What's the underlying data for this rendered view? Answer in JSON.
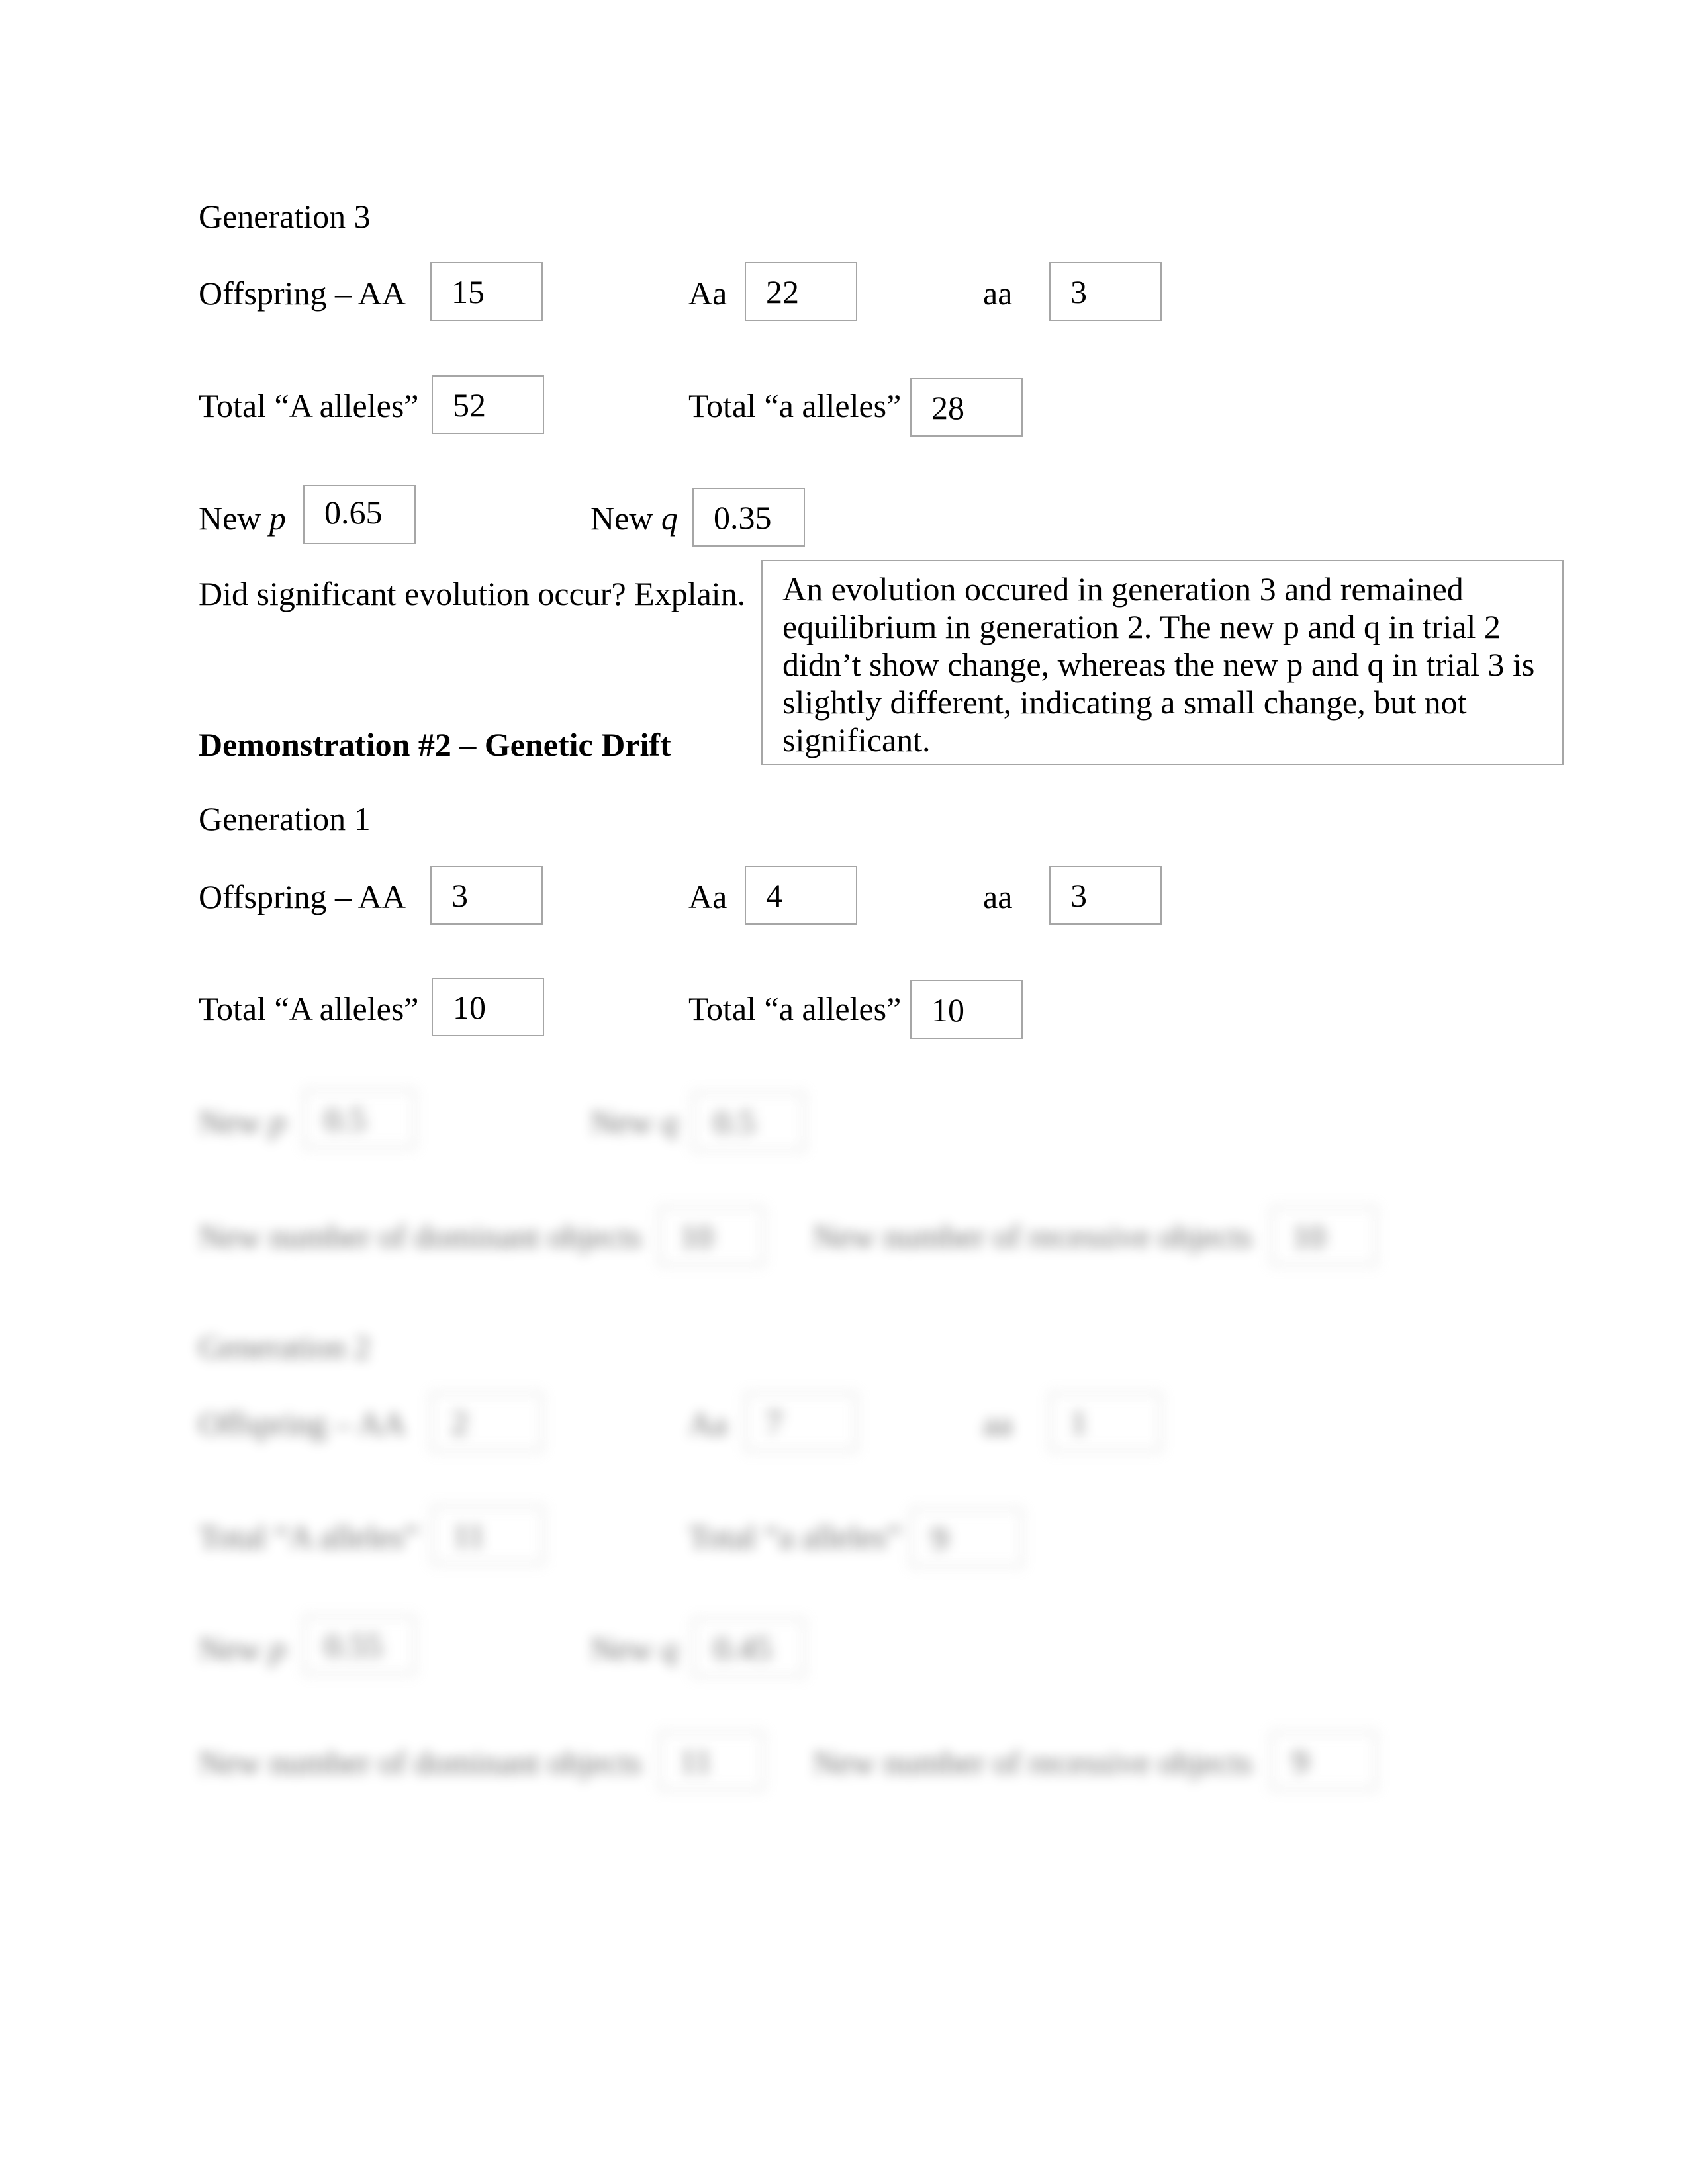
{
  "demo1": {
    "generation3": {
      "heading": "Generation 3",
      "offspring_label": "Offspring – AA",
      "AA": "15",
      "Aa_label": "Aa",
      "Aa": "22",
      "aa_label": "aa",
      "aa": "3",
      "total_A_label": "Total “A alleles”",
      "total_A": "52",
      "total_a_label": "Total “a alleles”",
      "total_a": "28",
      "new_p_label": "New ",
      "new_p_var": "p",
      "new_p": "0.65",
      "new_q_label": "New ",
      "new_q_var": "q",
      "new_q": "0.35"
    },
    "question": "Did significant evolution occur?  Explain.",
    "answer": "An evolution occured in generation 3 and remained equilibrium in generation 2. The new p and q in trial 2 didn’t show change, whereas the new p and q in trial 3 is slightly different, indicating a small change, but not significant."
  },
  "demo2": {
    "heading": "Demonstration #2 – Genetic Drift",
    "generation1": {
      "heading": "Generation 1",
      "offspring_label": "Offspring – AA",
      "AA": "3",
      "Aa_label": "Aa",
      "Aa": "4",
      "aa_label": "aa",
      "aa": "3",
      "total_A_label": "Total “A alleles”",
      "total_A": "10",
      "total_a_label": "Total “a alleles”",
      "total_a": "10",
      "new_p_label": "New ",
      "new_p_var": "p",
      "new_p": "0.5",
      "new_q_label": "New ",
      "new_q_var": "q",
      "new_q": "0.5",
      "dominant_label": "New number of dominant objects",
      "dominant": "10",
      "recessive_label": "New number of recessive objects",
      "recessive": "10"
    },
    "generation2": {
      "heading": "Generation 2",
      "offspring_label": "Offspring – AA",
      "AA": "2",
      "Aa_label": "Aa",
      "Aa": "7",
      "aa_label": "aa",
      "aa": "1",
      "total_A_label": "Total “A alleles”",
      "total_A": "11",
      "total_a_label": "Total “a alleles”",
      "total_a": "9",
      "new_p_label": "New ",
      "new_p_var": "p",
      "new_p": "0.55",
      "new_q_label": "New ",
      "new_q_var": "q",
      "new_q": "0.45",
      "dominant_label": "New number of dominant objects",
      "dominant": "11",
      "recessive_label": "New number of recessive objects",
      "recessive": "9"
    }
  }
}
